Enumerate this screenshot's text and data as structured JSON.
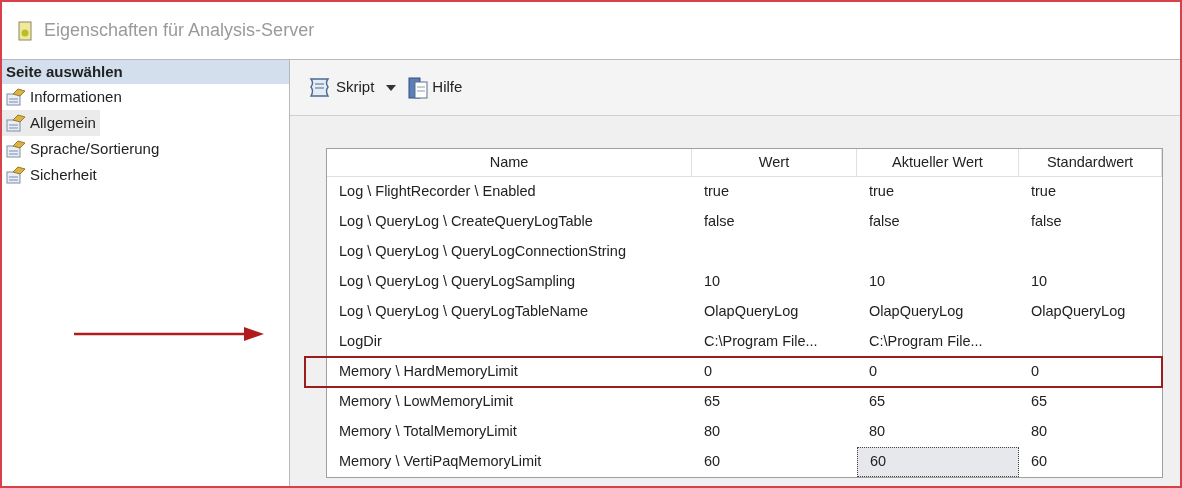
{
  "window": {
    "title": "Eigenschaften für Analysis-Server"
  },
  "sidebar": {
    "heading": "Seite auswählen",
    "items": [
      {
        "label": "Informationen",
        "selected": false
      },
      {
        "label": "Allgemein",
        "selected": true
      },
      {
        "label": "Sprache/Sortierung",
        "selected": false
      },
      {
        "label": "Sicherheit",
        "selected": false
      }
    ]
  },
  "toolbar": {
    "script_button": "Skript",
    "help_button": "Hilfe"
  },
  "table": {
    "columns": [
      "Name",
      "Wert",
      "Aktueller Wert",
      "Standardwert"
    ],
    "rows": [
      {
        "cells": [
          "Log \\ FlightRecorder \\ Enabled",
          "true",
          "true",
          "true"
        ],
        "highlighted": false
      },
      {
        "cells": [
          "Log \\ QueryLog \\ CreateQueryLogTable",
          "false",
          "false",
          "false"
        ],
        "highlighted": false
      },
      {
        "cells": [
          "Log \\ QueryLog \\ QueryLogConnectionString",
          null,
          null,
          null
        ],
        "highlighted": false
      },
      {
        "cells": [
          "Log \\ QueryLog \\ QueryLogSampling",
          "10",
          "10",
          "10"
        ],
        "highlighted": false
      },
      {
        "cells": [
          "Log \\ QueryLog \\ QueryLogTableName",
          "OlapQueryLog",
          "OlapQueryLog",
          "OlapQueryLog"
        ],
        "highlighted": false
      },
      {
        "cells": [
          "LogDir",
          "C:\\Program File...",
          "C:\\Program File...",
          null
        ],
        "highlighted": false
      },
      {
        "cells": [
          "Memory \\ HardMemoryLimit",
          "0",
          "0",
          "0"
        ],
        "highlighted": true
      },
      {
        "cells": [
          "Memory \\ LowMemoryLimit",
          "65",
          "65",
          "65"
        ],
        "highlighted": false
      },
      {
        "cells": [
          "Memory \\ TotalMemoryLimit",
          "80",
          "80",
          "80"
        ],
        "highlighted": false
      },
      {
        "cells": [
          "Memory \\ VertiPaqMemoryLimit",
          "60",
          {
            "text": "60",
            "focused": true
          },
          "60"
        ],
        "highlighted": false
      }
    ]
  }
}
